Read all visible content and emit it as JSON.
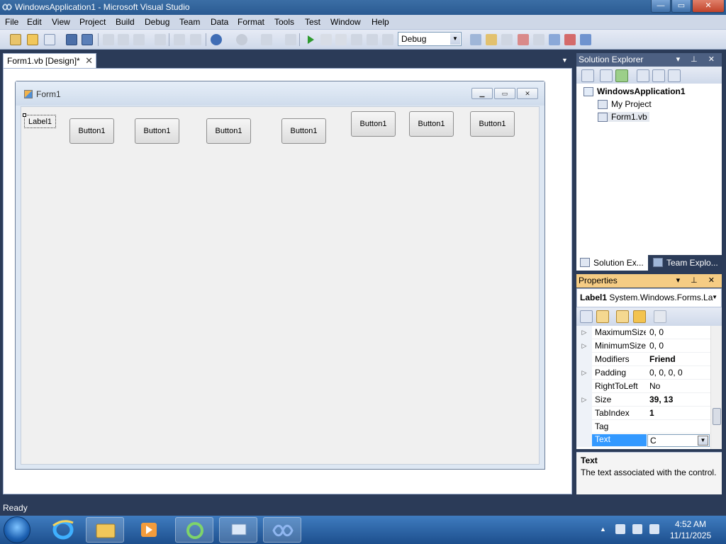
{
  "window": {
    "title": "WindowsApplication1 - Microsoft Visual Studio",
    "minimize_glyph": "—",
    "maximize_glyph": "▭",
    "close_glyph": "✕"
  },
  "menu": [
    "File",
    "Edit",
    "View",
    "Project",
    "Build",
    "Debug",
    "Team",
    "Data",
    "Format",
    "Tools",
    "Test",
    "Window",
    "Help"
  ],
  "toolbar": {
    "config_value": "Debug",
    "dropdown_glyph": "▼"
  },
  "document_tab": {
    "label": "Form1.vb [Design]*",
    "close_glyph": "✕",
    "dropdown_glyph": "▼"
  },
  "designer": {
    "form_caption": "Form1",
    "form_min_glyph": "▁",
    "form_max_glyph": "▭",
    "form_close_glyph": "✕",
    "label_text": "Label1",
    "buttons": [
      "Button1",
      "Button1",
      "Button1",
      "Button1",
      "Button1",
      "Button1",
      "Button1"
    ]
  },
  "solution_explorer": {
    "title": "Solution Explorer",
    "title_tools": "▾ ⊥ ✕",
    "tree": [
      "WindowsApplication1",
      "My Project",
      "Form1.vb"
    ],
    "tabs": [
      "Solution Ex...",
      "Team Explo..."
    ]
  },
  "properties": {
    "title": "Properties",
    "title_tools": "▾ ⊥ ✕",
    "object_name": "Label1",
    "object_type": "System.Windows.Forms.La",
    "object_dropdown": "▼",
    "rows": [
      {
        "expand": "▷",
        "name": "MaximumSize",
        "value": "0, 0",
        "bold": false
      },
      {
        "expand": "▷",
        "name": "MinimumSize",
        "value": "0, 0",
        "bold": false
      },
      {
        "expand": "",
        "name": "Modifiers",
        "value": "Friend",
        "bold": true
      },
      {
        "expand": "▷",
        "name": "Padding",
        "value": "0, 0, 0, 0",
        "bold": false
      },
      {
        "expand": "",
        "name": "RightToLeft",
        "value": "No",
        "bold": false
      },
      {
        "expand": "▷",
        "name": "Size",
        "value": "39, 13",
        "bold": true
      },
      {
        "expand": "",
        "name": "TabIndex",
        "value": "1",
        "bold": true
      },
      {
        "expand": "",
        "name": "Tag",
        "value": "",
        "bold": false
      },
      {
        "expand": "",
        "name": "Text",
        "value": "C",
        "bold": false
      }
    ],
    "edit_dropdown": "▼",
    "description_title": "Text",
    "description_text": "The text associated with the control."
  },
  "status": {
    "text": "Ready"
  },
  "taskbar": {
    "time": "4:52 AM",
    "date": "11/11/2025"
  }
}
